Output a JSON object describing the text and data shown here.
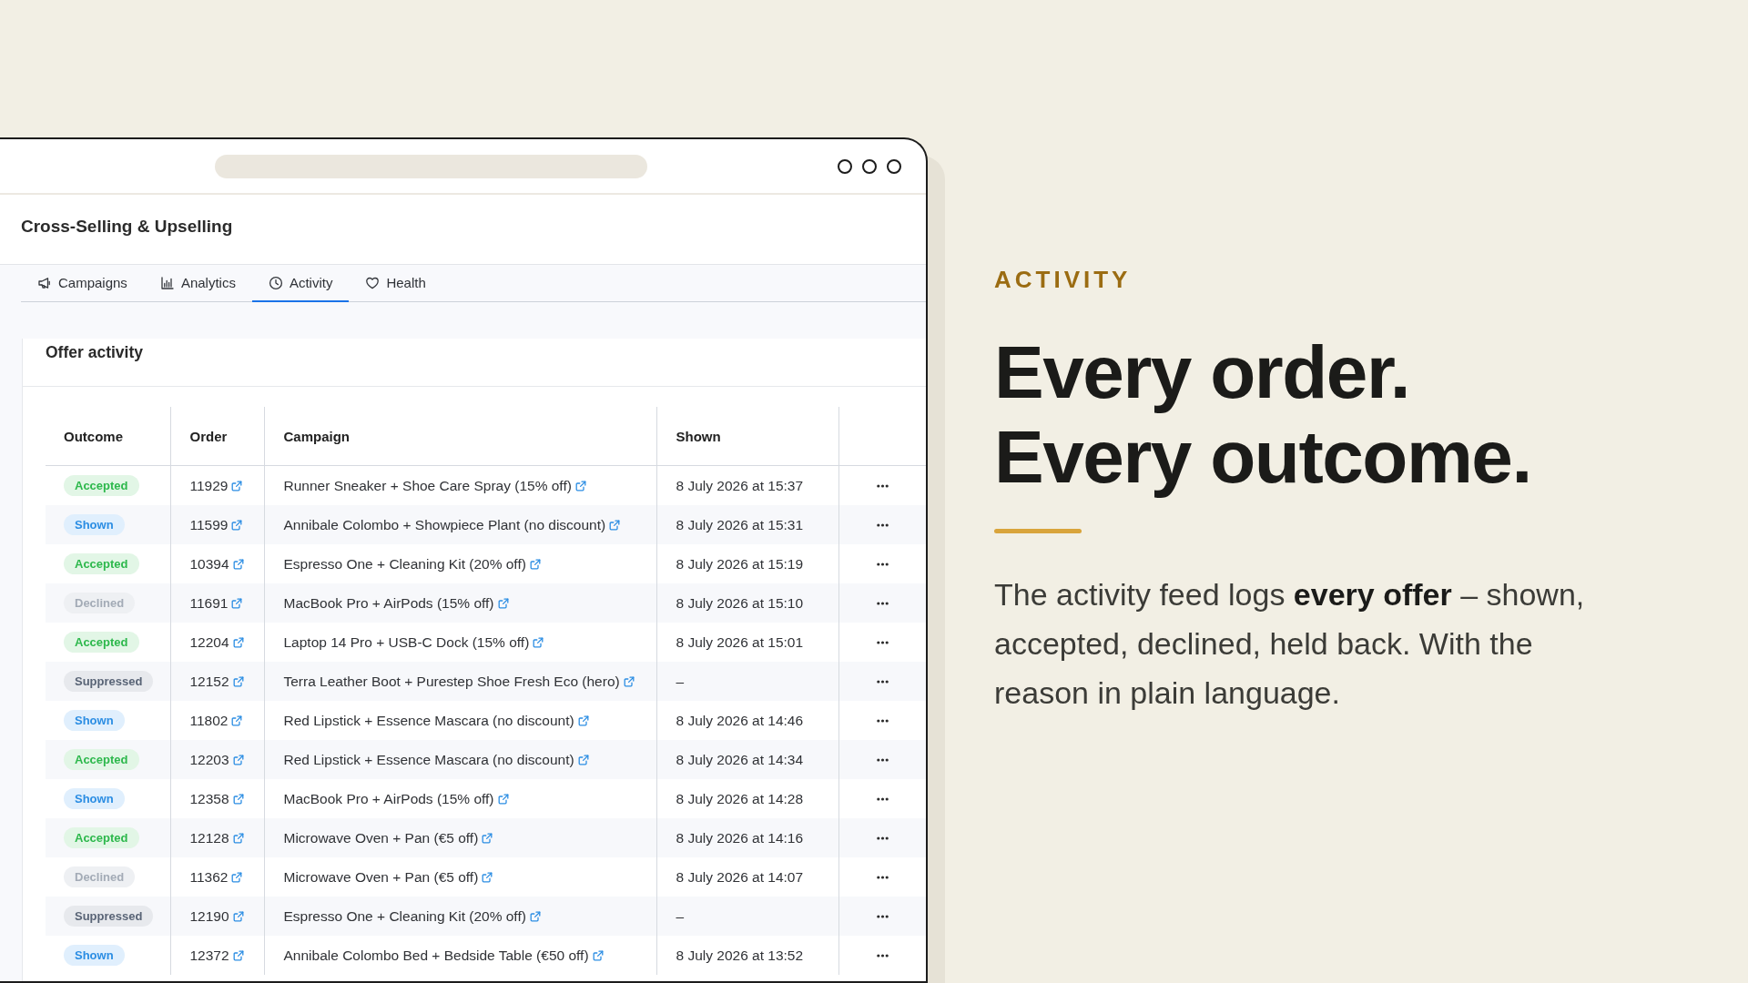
{
  "browser": {
    "app_title": "Cross-Selling & Upselling",
    "tabs": [
      {
        "label": "Campaigns",
        "selected": false
      },
      {
        "label": "Analytics",
        "selected": false
      },
      {
        "label": "Activity",
        "selected": true
      },
      {
        "label": "Health",
        "selected": false
      }
    ],
    "card": {
      "title": "Offer activity",
      "table": {
        "columns": [
          "Outcome",
          "Order",
          "Campaign",
          "Shown"
        ],
        "rows": [
          {
            "outcome": {
              "label": "Accepted",
              "kind": "accepted"
            },
            "order": "11929",
            "campaign": "Runner Sneaker + Shoe Care Spray (15% off)",
            "shown": "8 July 2026 at 15:37"
          },
          {
            "outcome": {
              "label": "Shown",
              "kind": "shown"
            },
            "order": "11599",
            "campaign": "Annibale Colombo + Showpiece Plant (no discount)",
            "shown": "8 July 2026 at 15:31"
          },
          {
            "outcome": {
              "label": "Accepted",
              "kind": "accepted"
            },
            "order": "10394",
            "campaign": "Espresso One + Cleaning Kit (20% off)",
            "shown": "8 July 2026 at 15:19"
          },
          {
            "outcome": {
              "label": "Declined",
              "kind": "declined"
            },
            "order": "11691",
            "campaign": "MacBook Pro + AirPods (15% off)",
            "shown": "8 July 2026 at 15:10"
          },
          {
            "outcome": {
              "label": "Accepted",
              "kind": "accepted"
            },
            "order": "12204",
            "campaign": "Laptop 14 Pro + USB-C Dock (15% off)",
            "shown": "8 July 2026 at 15:01"
          },
          {
            "outcome": {
              "label": "Suppressed",
              "kind": "suppressed"
            },
            "order": "12152",
            "campaign": "Terra Leather Boot + Purestep Shoe Fresh Eco (hero)",
            "shown": "–"
          },
          {
            "outcome": {
              "label": "Shown",
              "kind": "shown"
            },
            "order": "11802",
            "campaign": "Red Lipstick + Essence Mascara (no discount)",
            "shown": "8 July 2026 at 14:46"
          },
          {
            "outcome": {
              "label": "Accepted",
              "kind": "accepted"
            },
            "order": "12203",
            "campaign": "Red Lipstick + Essence Mascara (no discount)",
            "shown": "8 July 2026 at 14:34"
          },
          {
            "outcome": {
              "label": "Shown",
              "kind": "shown"
            },
            "order": "12358",
            "campaign": "MacBook Pro + AirPods (15% off)",
            "shown": "8 July 2026 at 14:28"
          },
          {
            "outcome": {
              "label": "Accepted",
              "kind": "accepted"
            },
            "order": "12128",
            "campaign": "Microwave Oven + Pan (€5 off)",
            "shown": "8 July 2026 at 14:16"
          },
          {
            "outcome": {
              "label": "Declined",
              "kind": "declined"
            },
            "order": "11362",
            "campaign": "Microwave Oven + Pan (€5 off)",
            "shown": "8 July 2026 at 14:07"
          },
          {
            "outcome": {
              "label": "Suppressed",
              "kind": "suppressed"
            },
            "order": "12190",
            "campaign": "Espresso One + Cleaning Kit (20% off)",
            "shown": "–"
          },
          {
            "outcome": {
              "label": "Shown",
              "kind": "shown"
            },
            "order": "12372",
            "campaign": "Annibale Colombo Bed + Bedside Table (€50 off)",
            "shown": "8 July 2026 at 13:52"
          }
        ]
      }
    }
  },
  "feature": {
    "eyebrow": "ACTIVITY",
    "headline": [
      "Every order.",
      "Every outcome."
    ],
    "body": "The activity feed logs **every offer** – shown, accepted, declined, held back. With the reason in plain language."
  }
}
